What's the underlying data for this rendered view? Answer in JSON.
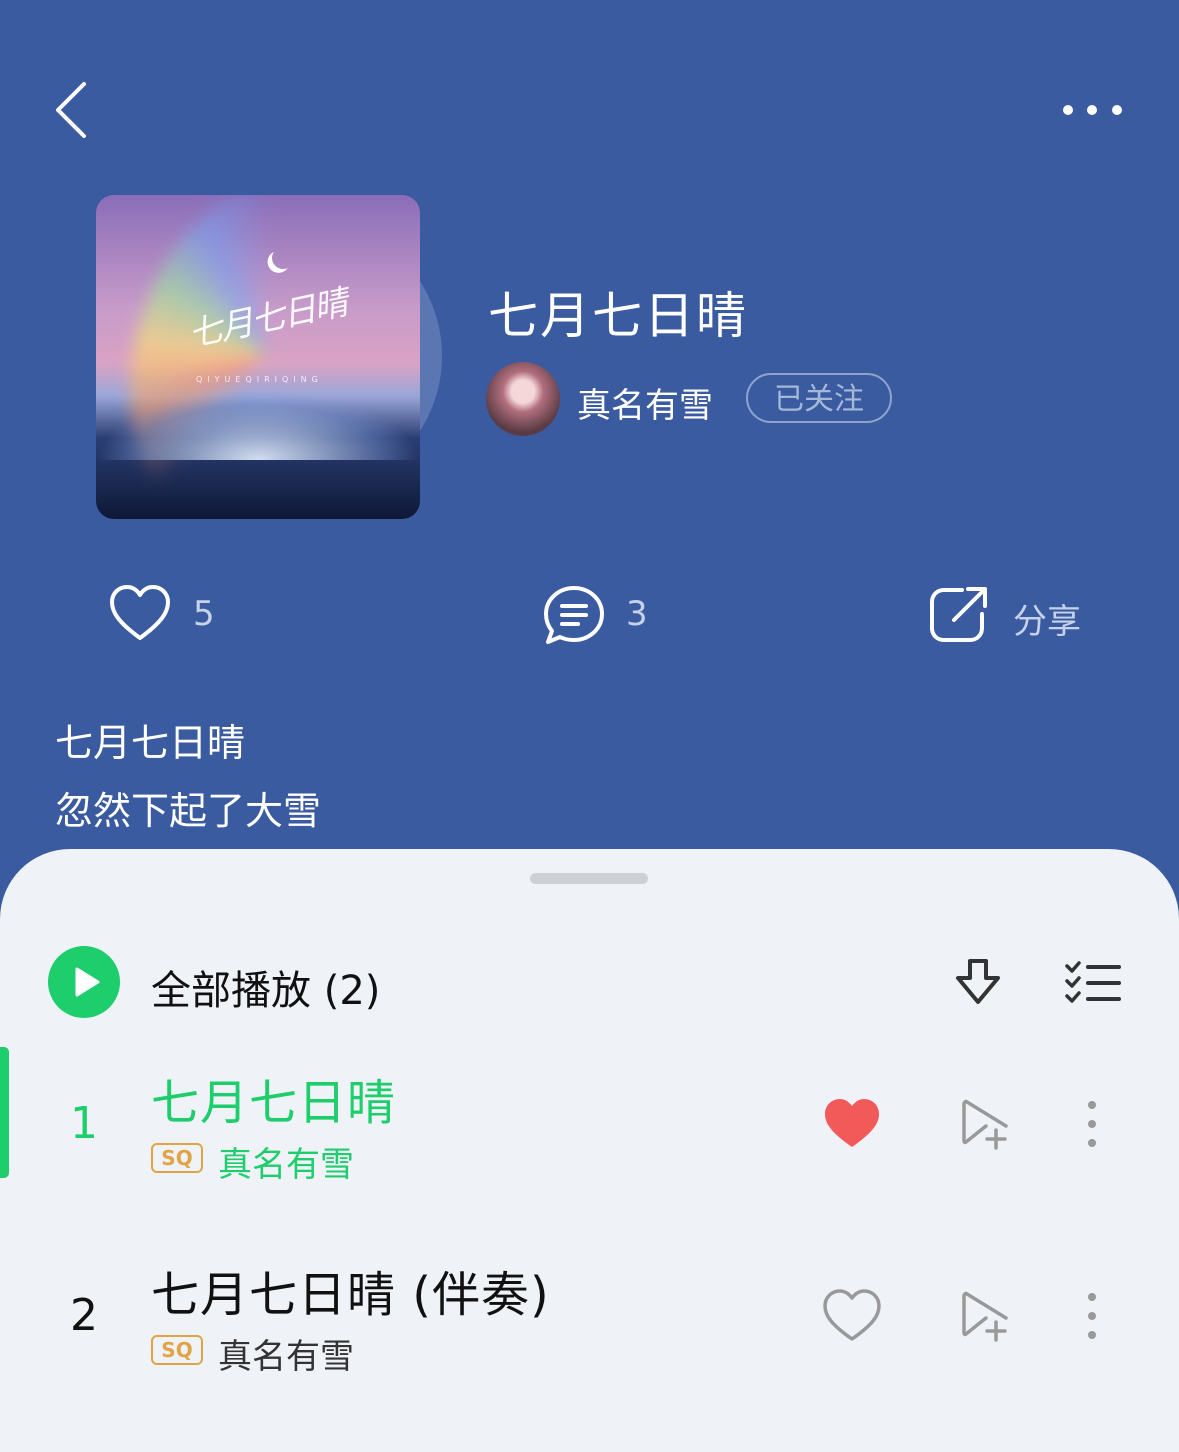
{
  "header": {
    "back_icon": "chevron-left-icon",
    "more_icon": "ellipsis-icon"
  },
  "album": {
    "cover_art_script": "七月七日晴",
    "cover_art_subtitle": "QIYUEQIRIQING",
    "title": "七月七日晴",
    "artist": "真名有雪",
    "follow_label": "已关注"
  },
  "actions": {
    "like_count": "5",
    "comment_count": "3",
    "share_label": "分享"
  },
  "description": {
    "line1": "七月七日晴",
    "line2": "忽然下起了大雪"
  },
  "playlist": {
    "play_all_label": "全部播放 (2)",
    "tracks": [
      {
        "index": "1",
        "title": "七月七日晴",
        "quality": "SQ",
        "artist": "真名有雪",
        "liked": true,
        "active": true
      },
      {
        "index": "2",
        "title": "七月七日晴 (伴奏)",
        "quality": "SQ",
        "artist": "真名有雪",
        "liked": false,
        "active": false
      }
    ]
  },
  "colors": {
    "accent": "#1ecd6c",
    "header_bg": "#3b5ba0",
    "liked": "#f25a5a",
    "sq_badge": "#e0a446"
  }
}
